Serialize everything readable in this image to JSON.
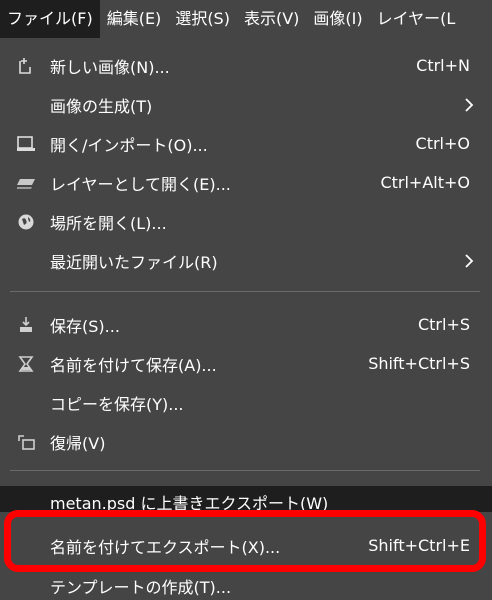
{
  "menubar": {
    "items": [
      "ファイル(F)",
      "編集(E)",
      "選択(S)",
      "表示(V)",
      "画像(I)",
      "レイヤー(L"
    ]
  },
  "file_menu": {
    "new": {
      "label": "新しい画像(N)...",
      "shortcut": "Ctrl+N"
    },
    "create": {
      "label": "画像の生成(T)"
    },
    "open": {
      "label": "開く/インポート(O)...",
      "shortcut": "Ctrl+O"
    },
    "open_as_layers": {
      "label": "レイヤーとして開く(E)...",
      "shortcut": "Ctrl+Alt+O"
    },
    "open_location": {
      "label": "場所を開く(L)..."
    },
    "recent": {
      "label": "最近開いたファイル(R)"
    },
    "save": {
      "label": "保存(S)...",
      "shortcut": "Ctrl+S"
    },
    "save_as": {
      "label": "名前を付けて保存(A)...",
      "shortcut": "Shift+Ctrl+S"
    },
    "save_copy": {
      "label": "コピーを保存(Y)..."
    },
    "revert": {
      "label": "復帰(V)"
    },
    "overwrite": {
      "label": "metan.psd に上書きエクスポート(W)"
    },
    "export_as": {
      "label": "名前を付けてエクスポート(X)...",
      "shortcut": "Shift+Ctrl+E"
    },
    "template": {
      "label": "テンプレートの作成(T)..."
    }
  },
  "colors": {
    "menu_bg": "#454545",
    "active_bg": "#1e1e1e",
    "annotation": "#ff0000"
  }
}
